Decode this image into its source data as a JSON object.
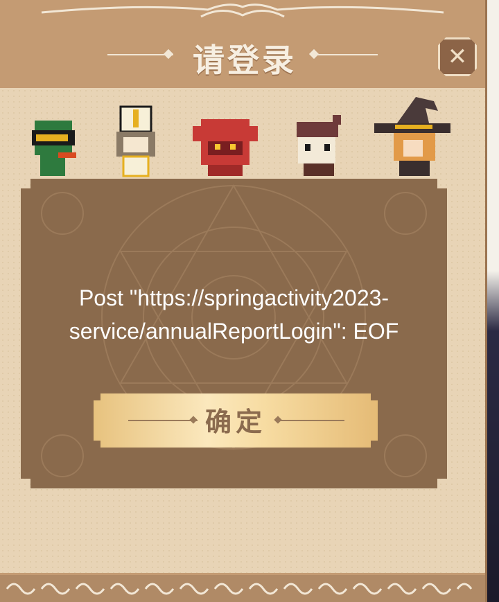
{
  "dialog": {
    "title": "请登录",
    "close_icon": "close-x-icon",
    "message": "Post \"https://springactivity2023-service/annualReportLogin\": EOF",
    "confirm_label": "确定"
  },
  "characters": [
    "green-helmet-knight-icon",
    "white-hat-cleric-icon",
    "red-horned-warrior-icon",
    "hooded-rogue-icon",
    "witch-hat-mage-icon"
  ],
  "colors": {
    "frame": "#c49b73",
    "paper": "#e8d4b6",
    "panel": "#8a6a4c",
    "button": "#f7dca2",
    "text": "#ffffff"
  }
}
